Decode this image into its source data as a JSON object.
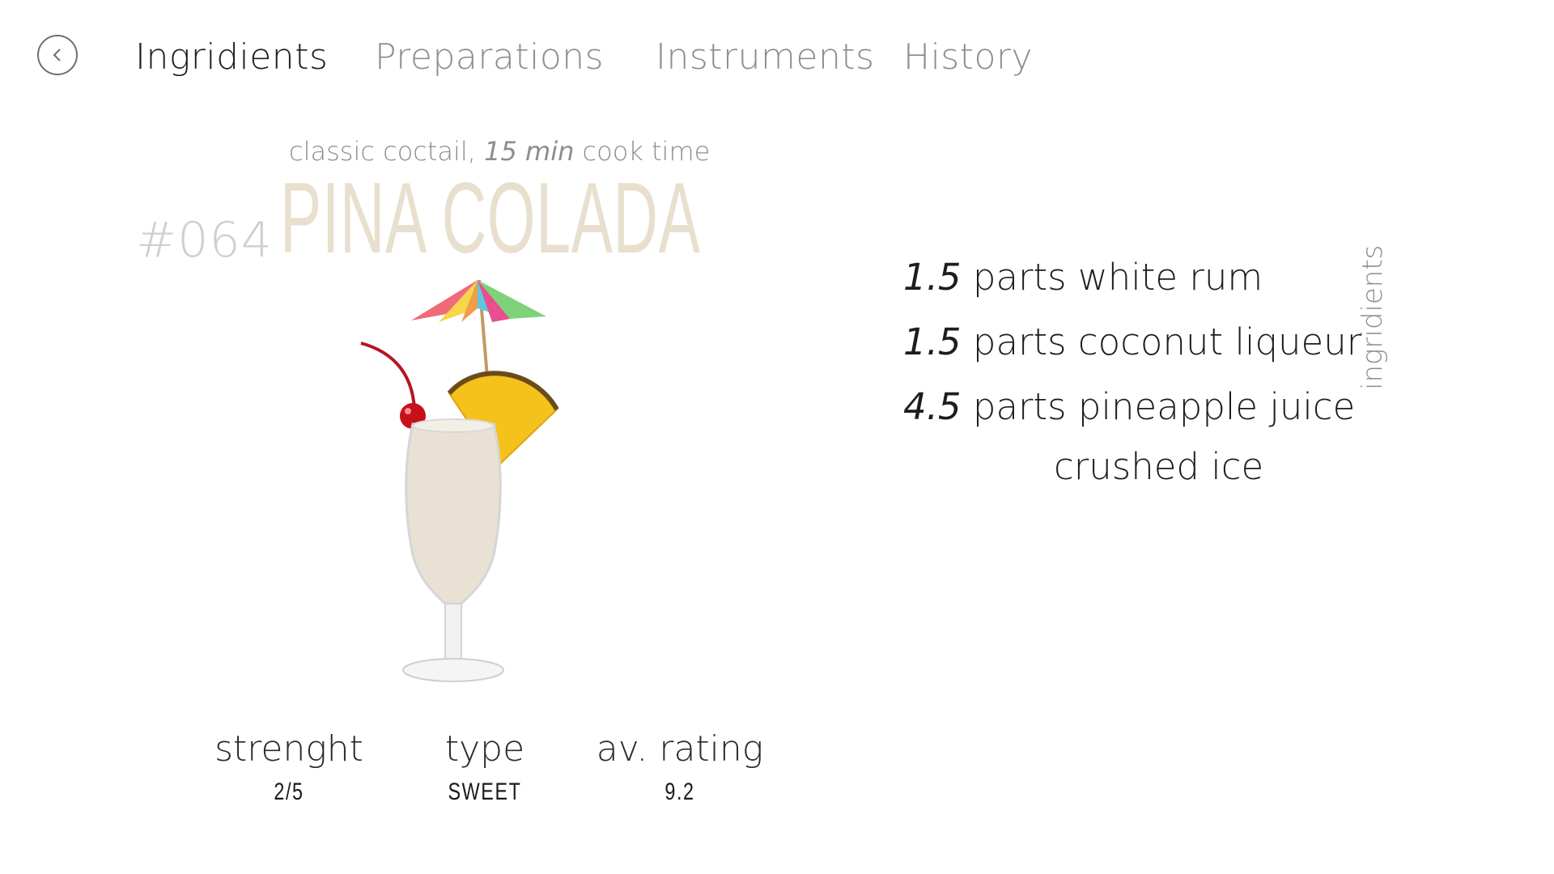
{
  "nav": {
    "back_icon": "chevron-left-icon",
    "tabs": [
      {
        "label": "Ingridients",
        "active": true
      },
      {
        "label": "Preparations",
        "active": false
      },
      {
        "label": "Instruments",
        "active": false
      },
      {
        "label": "History",
        "active": false
      }
    ]
  },
  "drink": {
    "subtitle_prefix": "classic coctail, ",
    "subtitle_time": "15 min",
    "subtitle_suffix": " cook time",
    "number": "#064",
    "name": "PINA COLADA"
  },
  "stats": [
    {
      "label": "strenght",
      "value": "2/5"
    },
    {
      "label": "type",
      "value": "SWEET"
    },
    {
      "label": "av. rating",
      "value": "9.2"
    }
  ],
  "ingredients": [
    {
      "qty": "1.5",
      "text": " parts white rum"
    },
    {
      "qty": "1.5",
      "text": " parts coconut liqueur"
    },
    {
      "qty": "4.5",
      "text": " parts pineapple juice"
    },
    {
      "qty": "",
      "text": "crushed ice"
    }
  ],
  "side_label": "ingridients",
  "colors": {
    "title": "#e9dfcf",
    "number": "#cfcfcf",
    "inactive_tab": "#8e8e8e",
    "drink": "#e8e1d4"
  }
}
